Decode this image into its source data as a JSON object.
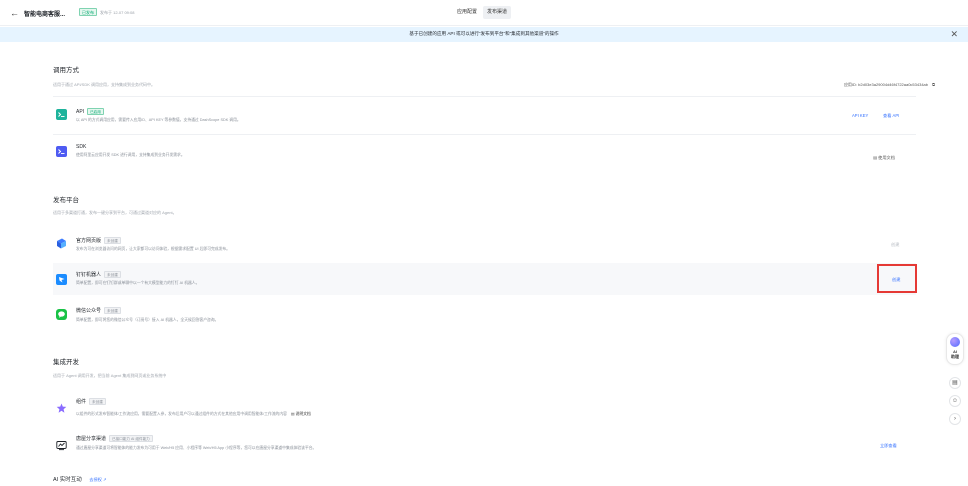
{
  "header": {
    "back_glyph": "←",
    "app_title": "智能电商客服...",
    "status_badge": "已发布",
    "publish_time": "发布于 12-07 09:08",
    "tabs": [
      "应用配置",
      "发布渠道"
    ]
  },
  "notice": {
    "text": "基于已创建的应用 API 或可以进行“发布到平台”和“集成到其他渠道”的操作",
    "close_glyph": "✕"
  },
  "call": {
    "title": "调用方式",
    "subtitle": "适用于通过 API/SDK 调用应用，支持集成到业务代码中。",
    "app_id": "应用ID: b2d03e3a29004d46f4722aa0c53434ab",
    "rows": [
      {
        "title": "API",
        "tag": "已启用",
        "desc": "以 API 的方式调用应用，需要传入应用ID、API KEY 等参数值，支持通过 DashScope SDK 调用。",
        "actions": [
          "API KEY",
          "查看 API"
        ]
      },
      {
        "title": "SDK",
        "desc": "使用阿里云应用开发 SDK 进行调用，支持集成到业务开发需求。",
        "actions": [
          "使用文档"
        ]
      }
    ]
  },
  "publish": {
    "title": "发布平台",
    "subtitle": "适用于多渠道打通，发布一键分享到平台，可通过渠道对应的 Agent。",
    "rows": [
      {
        "title": "官方网页版",
        "tag": "未创建",
        "desc": "发布为可在浏览器访问的网页，让大家都可以访问体验，根据需求配置 UI 后即可完成发布。",
        "action": "创建"
      },
      {
        "title": "钉钉机器人",
        "tag": "未创建",
        "desc": "简单配置，即可在钉钉群或单聊中以一个有大模型能力的钉钉 AI 机器人。",
        "action": "创建"
      },
      {
        "title": "微信公众号",
        "tag": "未创建",
        "desc": "简单配置，即可将您的微信公众号（订阅号）接入 AI 机器人，全天候回答客户咨询。",
        "action": ""
      }
    ]
  },
  "integrate": {
    "title": "集成开发",
    "subtitle": "适用于 Agent 调用开发，把当前 Agent 集成到网页或业务系统中",
    "rows": [
      {
        "title": "组件",
        "tag": "未创建",
        "desc": "以组件的形式发布智能体/工作流应用，需要配置入参，发布后用户可以通过组件的方式在其他应用中调用智能体/工作流的内容",
        "link": "说明文档"
      },
      {
        "title": "唐屋分享渠道",
        "tag": "已接口能力 AI 组件能力",
        "desc": "通过唐屋分享渠道可将智能体的能力发布为可用于 Web/H5 应用、小程序等 Web/H5 App 小程序等，您可以在唐屋分享渠道中集成体验该平台。",
        "action": "立即查看"
      }
    ]
  },
  "ai_interaction": {
    "title": "AI 实时互动",
    "link": "去授权 ↗"
  },
  "float": {
    "ai_label": "AI\n助理"
  },
  "side_buttons": [
    "▤",
    "☺",
    "›"
  ]
}
